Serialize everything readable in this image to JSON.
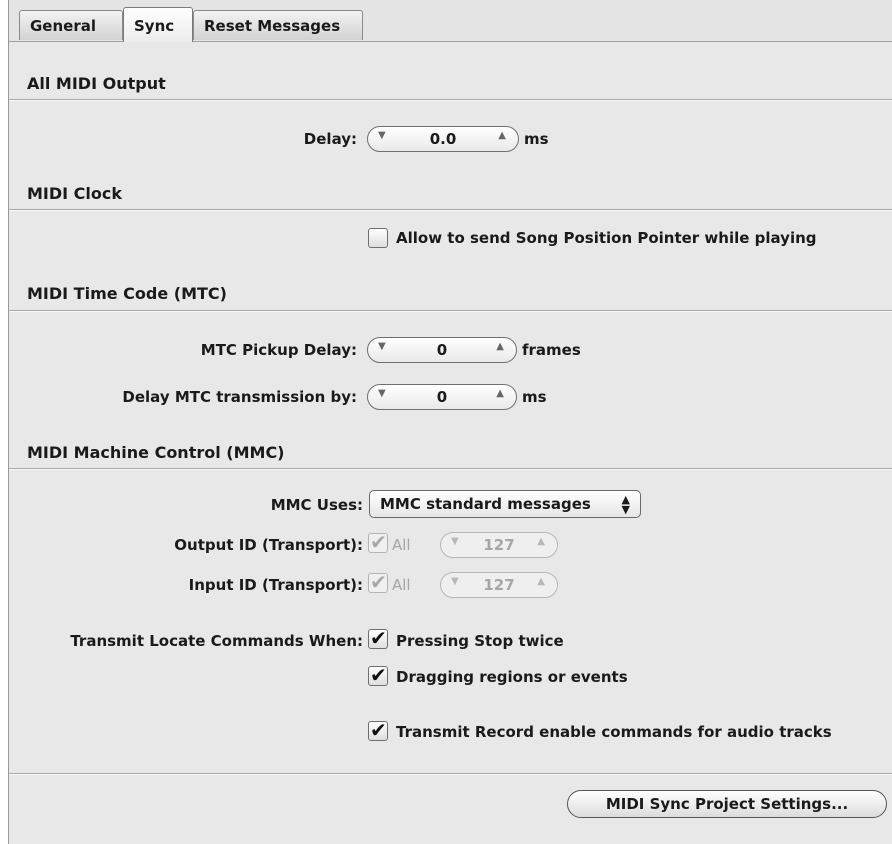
{
  "tabs": [
    "General",
    "Sync",
    "Reset Messages"
  ],
  "all_midi_output": {
    "title": "All MIDI Output",
    "delay_label": "Delay:",
    "delay_value": "0.0",
    "delay_unit": "ms"
  },
  "midi_clock": {
    "title": "MIDI Clock",
    "spp_label": "Allow to send Song Position Pointer while playing",
    "spp_checked": false
  },
  "mtc": {
    "title": "MIDI Time Code (MTC)",
    "pickup_label": "MTC Pickup Delay:",
    "pickup_value": "0",
    "pickup_unit": "frames",
    "transmission_label": "Delay MTC transmission by:",
    "transmission_value": "0",
    "transmission_unit": "ms"
  },
  "mmc": {
    "title": "MIDI Machine Control (MMC)",
    "uses_label": "MMC Uses:",
    "uses_value": "MMC standard messages",
    "output_label": "Output ID (Transport):",
    "output_all_label": "All",
    "output_value": "127",
    "input_label": "Input ID (Transport):",
    "input_all_label": "All",
    "input_value": "127",
    "locate_label": "Transmit Locate Commands When:",
    "pressing_stop_label": "Pressing Stop twice",
    "dragging_label": "Dragging regions or events",
    "record_enable_label": "Transmit Record enable commands for audio tracks"
  },
  "footer": {
    "project_settings_button": "MIDI Sync Project Settings..."
  },
  "icons": {
    "stepper_down": "triangle-down-icon",
    "stepper_up": "triangle-up-icon",
    "popup_arrows": "up-down-arrows-icon",
    "check": "checkmark-icon"
  }
}
